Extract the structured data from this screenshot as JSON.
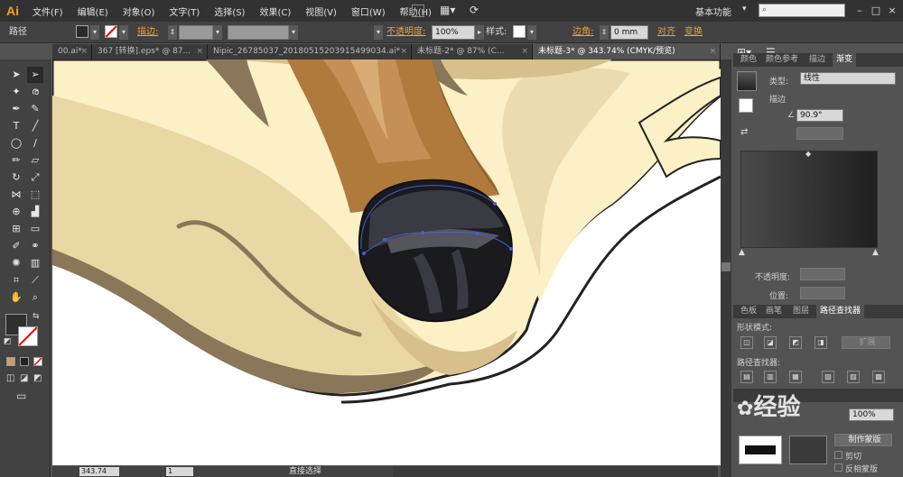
{
  "app": {
    "logo": "Ai",
    "workspace": "基本功能"
  },
  "menu": [
    "文件(F)",
    "编辑(E)",
    "对象(O)",
    "文字(T)",
    "选择(S)",
    "效果(C)",
    "视图(V)",
    "窗口(W)",
    "帮助(H)"
  ],
  "control": {
    "object_type": "路径",
    "stroke_label": "描边:",
    "stroke_style": "基本",
    "opacity_label": "不透明度:",
    "opacity_value": "100%",
    "style_label": "样式:",
    "corner_label": "边角:",
    "corner_value": "0 mm",
    "align_label": "对齐",
    "transform_label": "变换"
  },
  "tabs": [
    {
      "label": "00.ai*",
      "active": false
    },
    {
      "label": "367 [转换].eps* @ 87...",
      "active": false
    },
    {
      "label": "Nipic_26785037_20180515203915499034.ai*",
      "active": false
    },
    {
      "label": "未标题-2* @ 87% (C...",
      "active": false
    },
    {
      "label": "未标题-3* @ 343.74% (CMYK/预览)",
      "active": true
    }
  ],
  "status": {
    "zoom": "343.74",
    "page": "1",
    "tool": "直接选择"
  },
  "gradient_panel": {
    "tabs": [
      "颜色",
      "颜色参考",
      "描边",
      "渐变"
    ],
    "type_label": "类型:",
    "type_value": "线性",
    "stroke_label": "描边",
    "angle_value": "90.9°",
    "opacity_label": "不透明度:",
    "position_label": "位置:"
  },
  "pathfinder_panel": {
    "tabs": [
      "色板",
      "画笔",
      "图层",
      "路径查找器"
    ],
    "shape_modes_label": "形状模式:",
    "expand_label": "扩展",
    "pathfinders_label": "路径查找器:"
  },
  "transparency_panel": {
    "opacity_value": "100%",
    "make_mask_label": "制作蒙版",
    "clip_label": "剪切",
    "invert_label": "反相蒙版"
  },
  "watermark": "经验",
  "colors": {
    "fur_cream": "#fbf0c6",
    "fur_tan": "#d7c08c",
    "fur_shadow": "#8a7658",
    "nose_brown": "#b07a3c",
    "nose_dark": "#1a1a1f",
    "selection_blue": "#4a5bd6",
    "accent_orange": "#f7a31c"
  }
}
